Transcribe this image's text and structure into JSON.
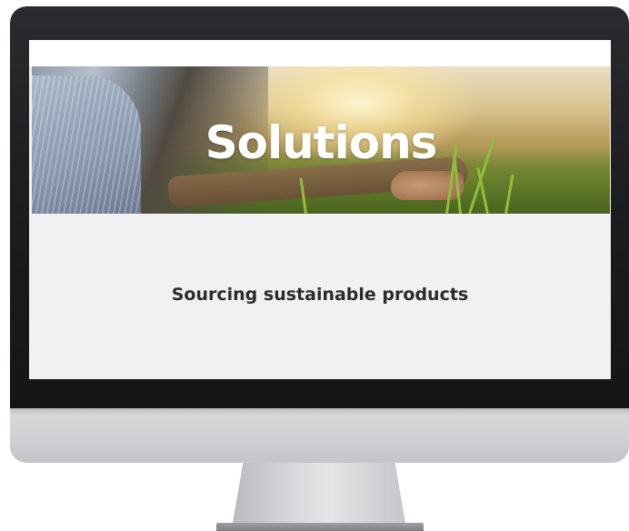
{
  "hero": {
    "title": "Solutions"
  },
  "content": {
    "subtitle": "Sourcing sustainable products"
  },
  "colors": {
    "bezel": "#1d1e20",
    "screen_background": "#f1f1f3",
    "chin": "#d9dadc",
    "subtitle_text": "#2b2b2e",
    "hero_title_text": "#ffffff"
  }
}
